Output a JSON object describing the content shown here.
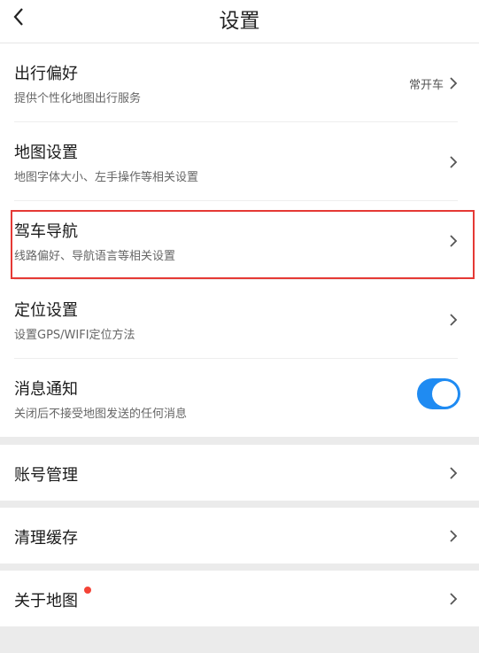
{
  "header": {
    "title": "设置"
  },
  "settings": {
    "travel": {
      "label": "出行偏好",
      "sub": "提供个性化地图出行服务",
      "value": "常开车"
    },
    "map": {
      "label": "地图设置",
      "sub": "地图字体大小、左手操作等相关设置"
    },
    "driving": {
      "label": "驾车导航",
      "sub": "线路偏好、导航语言等相关设置"
    },
    "location": {
      "label": "定位设置",
      "sub": "设置GPS/WIFI定位方法"
    },
    "notify": {
      "label": "消息通知",
      "sub": "关闭后不接受地图发送的任何消息",
      "enabled": true
    }
  },
  "account": {
    "label": "账号管理"
  },
  "cache": {
    "label": "清理缓存"
  },
  "about": {
    "label": "关于地图",
    "has_badge": true
  },
  "colors": {
    "accent": "#1f8bf2",
    "highlight": "#e53935",
    "badge": "#f44336"
  },
  "icons": {
    "back": "chevron-left-icon",
    "row": "chevron-right-icon"
  }
}
